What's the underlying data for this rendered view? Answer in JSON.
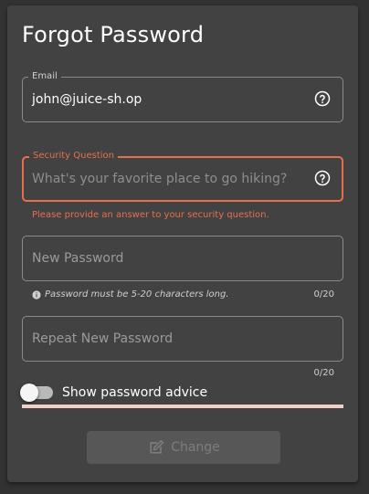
{
  "title": "Forgot Password",
  "email": {
    "label": "Email",
    "value": "john@juice-sh.op",
    "help_icon": "help-circle-icon"
  },
  "security_question": {
    "label": "Security Question",
    "placeholder": "What's your favorite place to go hiking?",
    "error": "Please provide an answer to your security question.",
    "help_icon": "help-circle-icon"
  },
  "new_password": {
    "placeholder": "New Password",
    "hint": "Password must be 5-20 characters long.",
    "hint_icon": "info-icon",
    "counter": "0/20"
  },
  "repeat_password": {
    "placeholder": "Repeat New Password",
    "counter": "0/20"
  },
  "show_advice": {
    "label": "Show password advice",
    "checked": false
  },
  "password_strength": 0,
  "change_button": {
    "label": "Change",
    "icon": "edit-icon",
    "disabled": true
  },
  "colors": {
    "background": "#323232",
    "card": "#424242",
    "error": "#e86f4c",
    "border": "#8a8a8a"
  }
}
